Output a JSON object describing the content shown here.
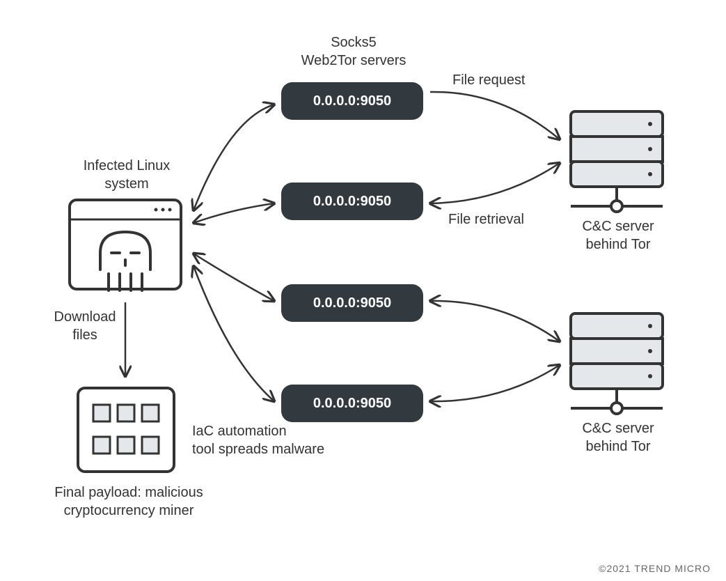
{
  "labels": {
    "infected_system_1": "Infected Linux",
    "infected_system_2": "system",
    "socks5_1": "Socks5",
    "socks5_2": "Web2Tor servers",
    "download_1": "Download",
    "download_2": "files",
    "payload_1": "Final payload: malicious",
    "payload_2": "cryptocurrency miner",
    "iac_1": "IaC automation",
    "iac_2": "tool spreads malware",
    "file_request": "File request",
    "file_retrieval": "File retrieval",
    "cc_server_1a": "C&C server",
    "cc_server_1b": "behind Tor",
    "cc_server_2a": "C&C server",
    "cc_server_2b": "behind Tor"
  },
  "servers": {
    "ip1": "0.0.0.0:9050",
    "ip2": "0.0.0.0:9050",
    "ip3": "0.0.0.0:9050",
    "ip4": "0.0.0.0:9050"
  },
  "copyright": "©2021 TREND MICRO"
}
